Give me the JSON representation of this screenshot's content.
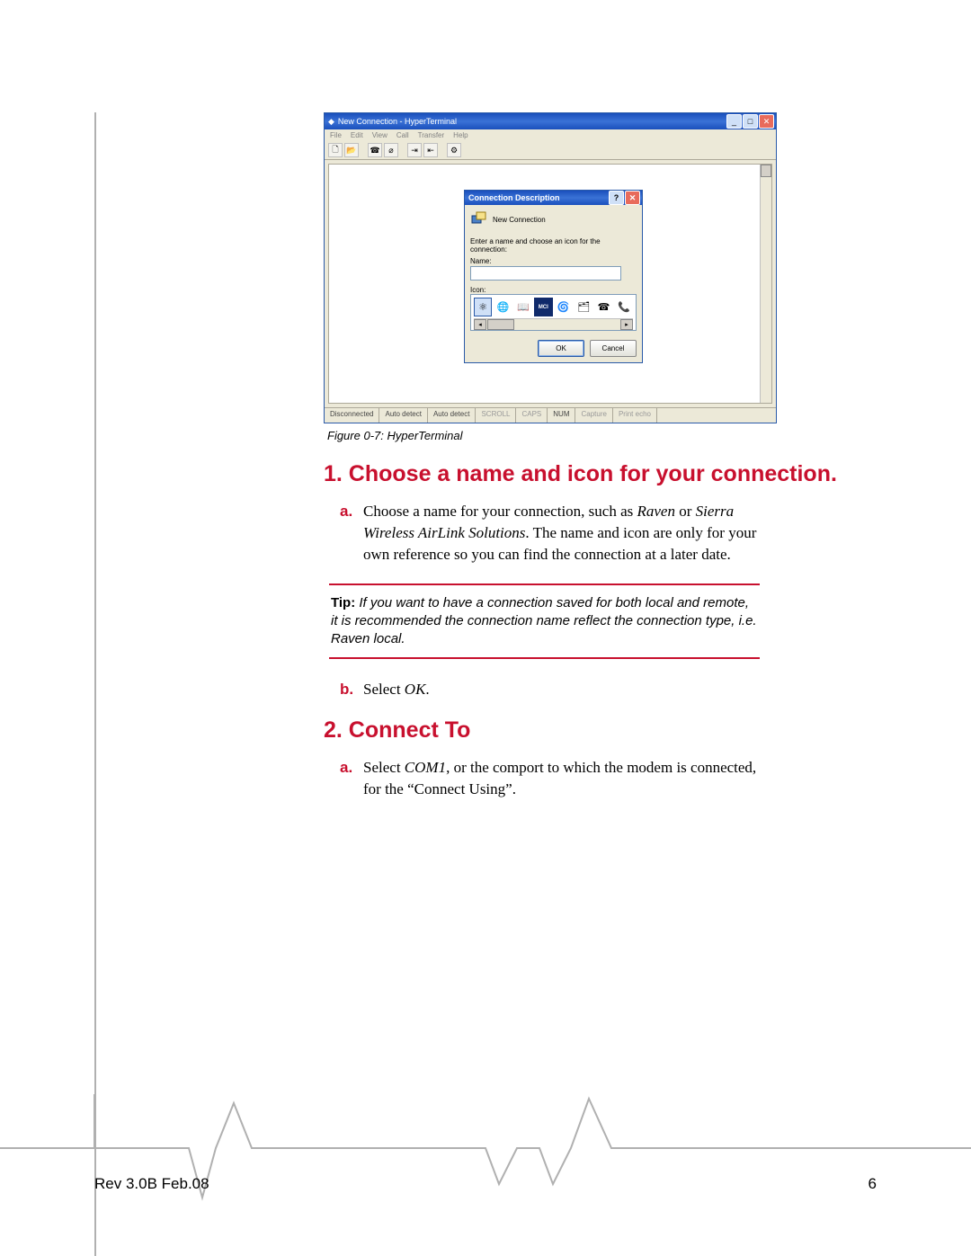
{
  "hyperterminal": {
    "window_title": "New Connection - HyperTerminal",
    "menubar": [
      "File",
      "Edit",
      "View",
      "Call",
      "Transfer",
      "Help"
    ],
    "statusbar": {
      "conn": "Disconnected",
      "detect1": "Auto detect",
      "detect2": "Auto detect",
      "scroll": "SCROLL",
      "caps": "CAPS",
      "num": "NUM",
      "capture": "Capture",
      "echo": "Print echo"
    }
  },
  "dialog": {
    "title": "Connection Description",
    "new_connection_label": "New Connection",
    "prompt": "Enter a name and choose an icon for the connection:",
    "name_label": "Name:",
    "icon_label": "Icon:",
    "ok": "OK",
    "cancel": "Cancel",
    "icons": [
      "atom",
      "globe",
      "book",
      "mci",
      "spiral-globe",
      "folder",
      "phone1",
      "phone2"
    ]
  },
  "figure_caption": "Figure 0-7: HyperTerminal",
  "heading1": "1. Choose a name and icon for your connection.",
  "step1a_prefix": "Choose a name for your connection, such as ",
  "step1a_em1": "Raven",
  "step1a_mid": " or ",
  "step1a_em2": "Sierra Wireless AirLink Solutions",
  "step1a_suffix": ". The name and icon are only for your own reference so you can find the connection at a later date.",
  "tip_label": "Tip: ",
  "tip_body": "If you want to have a connection saved for both local and remote, it is recommended the connection name reflect the connection type, i.e. Raven local.",
  "step1b_prefix": "Select ",
  "step1b_em": "OK",
  "step1b_suffix": ".",
  "heading2": "2. Connect To",
  "step2a_prefix": "Select ",
  "step2a_em": "COM1",
  "step2a_suffix": ", or the comport to which the modem is connected, for the “Connect Using”.",
  "footer_rev": "Rev 3.0B  Feb.08",
  "footer_page": "6",
  "markers": {
    "a": "a.",
    "b": "b."
  }
}
